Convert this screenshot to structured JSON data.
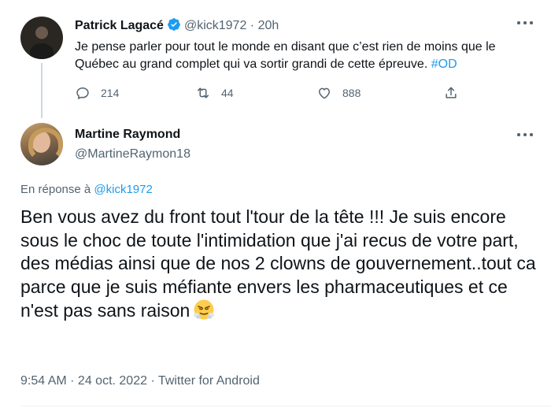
{
  "parent_tweet": {
    "author_name": "Patrick Lagacé",
    "author_handle": "@kick1972",
    "separator": "·",
    "time": "20h",
    "text_main": "Je pense parler pour tout le monde en disant que c’est rien de moins que le Québec au grand complet qui va sortir grandi de cette épreuve. ",
    "hashtag": "#OD",
    "replies": "214",
    "retweets": "44",
    "likes": "888"
  },
  "reply_tweet": {
    "author_name": "Martine Raymond",
    "author_handle": "@MartineRaymon18",
    "reply_prefix": "En réponse à ",
    "reply_to_handle": "@kick1972",
    "text": "Ben vous avez du front tout l'tour de la tête !!! Je suis encore sous le choc de toute l'intimidation que j'ai recus de votre part, des médias ainsi que de nos 2 clowns de gouvernement..tout ca parce que je suis méfiante envers les pharmaceutiques et ce n'est pas sans raison",
    "emoji_icon": "steam-from-nose-face",
    "meta": "9:54 AM · 24 oct. 2022 · Twitter for Android"
  },
  "colors": {
    "accent": "#1d9bf0",
    "secondary_text": "#536471",
    "primary_text": "#0f1419"
  }
}
